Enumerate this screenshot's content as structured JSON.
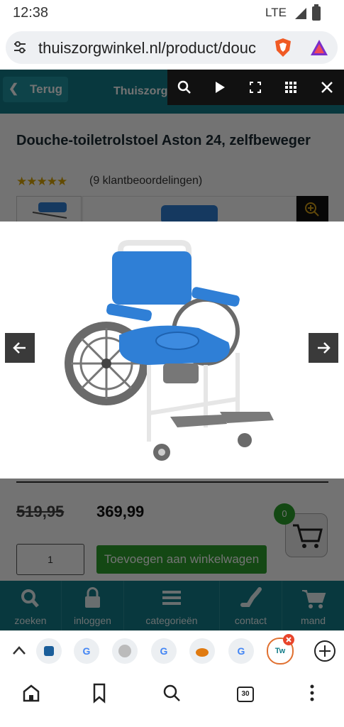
{
  "status_bar": {
    "time": "12:38",
    "network": "LTE"
  },
  "browser": {
    "url": "thuiszorgwinkel.nl/product/douc"
  },
  "site": {
    "back_label": "Terug",
    "title": "Thuiszorgwinkel"
  },
  "lightbox_toolbar": {
    "icons": [
      "search-icon",
      "play-icon",
      "fullscreen-icon",
      "grid-icon",
      "close-icon"
    ]
  },
  "product": {
    "title": "Douche-toiletrolstoel Aston 24, zelfbeweger",
    "rating_stars": 5,
    "reviews": "(9 klantbeoordelingen)",
    "old_price": "519,95",
    "new_price": "369,99",
    "quantity": "1",
    "add_to_cart": "Toevoegen aan winkelwagen",
    "cart_count": "0"
  },
  "bottom_nav": [
    {
      "label": "zoeken",
      "icon": "search-icon"
    },
    {
      "label": "inloggen",
      "icon": "lock-icon"
    },
    {
      "label": "categorieën",
      "icon": "menu-icon"
    },
    {
      "label": "contact",
      "icon": "phone-icon"
    },
    {
      "label": "mand",
      "icon": "cart-icon"
    }
  ],
  "tabs": [
    {
      "icon": "app-tab-icon"
    },
    {
      "letter": "G"
    },
    {
      "icon": "reader-tab-icon"
    },
    {
      "letter": "G"
    },
    {
      "icon": "bird-tab-icon"
    },
    {
      "letter": "G"
    },
    {
      "letter": "Tw"
    }
  ],
  "bottom_bar": {
    "tab_count": "30"
  },
  "colors": {
    "site_teal": "#137d8a",
    "add_green": "#2ea02e",
    "chair_blue": "#2f7fd6"
  }
}
